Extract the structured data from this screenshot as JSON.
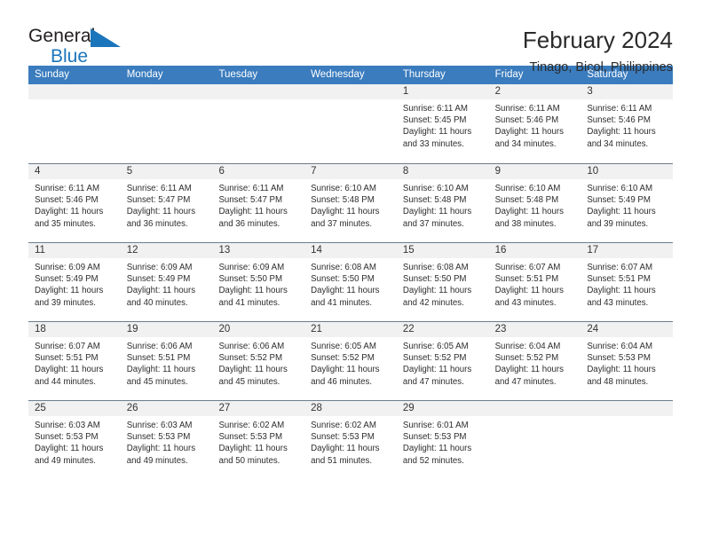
{
  "logo": {
    "word1": "General",
    "word2": "Blue",
    "accent_color": "#1b75bb"
  },
  "header": {
    "title": "February 2024",
    "location": "Tinago, Bicol, Philippines",
    "header_bg": "#3a7cbe"
  },
  "weekdays": [
    "Sunday",
    "Monday",
    "Tuesday",
    "Wednesday",
    "Thursday",
    "Friday",
    "Saturday"
  ],
  "labels": {
    "sunrise": "Sunrise:",
    "sunset": "Sunset:",
    "daylight": "Daylight:"
  },
  "weeks": [
    [
      {
        "day": "",
        "sunrise": "",
        "sunset": "",
        "daylight_1": "",
        "daylight_2": ""
      },
      {
        "day": "",
        "sunrise": "",
        "sunset": "",
        "daylight_1": "",
        "daylight_2": ""
      },
      {
        "day": "",
        "sunrise": "",
        "sunset": "",
        "daylight_1": "",
        "daylight_2": ""
      },
      {
        "day": "",
        "sunrise": "",
        "sunset": "",
        "daylight_1": "",
        "daylight_2": ""
      },
      {
        "day": "1",
        "sunrise": "Sunrise: 6:11 AM",
        "sunset": "Sunset: 5:45 PM",
        "daylight_1": "Daylight: 11 hours",
        "daylight_2": "and 33 minutes."
      },
      {
        "day": "2",
        "sunrise": "Sunrise: 6:11 AM",
        "sunset": "Sunset: 5:46 PM",
        "daylight_1": "Daylight: 11 hours",
        "daylight_2": "and 34 minutes."
      },
      {
        "day": "3",
        "sunrise": "Sunrise: 6:11 AM",
        "sunset": "Sunset: 5:46 PM",
        "daylight_1": "Daylight: 11 hours",
        "daylight_2": "and 34 minutes."
      }
    ],
    [
      {
        "day": "4",
        "sunrise": "Sunrise: 6:11 AM",
        "sunset": "Sunset: 5:46 PM",
        "daylight_1": "Daylight: 11 hours",
        "daylight_2": "and 35 minutes."
      },
      {
        "day": "5",
        "sunrise": "Sunrise: 6:11 AM",
        "sunset": "Sunset: 5:47 PM",
        "daylight_1": "Daylight: 11 hours",
        "daylight_2": "and 36 minutes."
      },
      {
        "day": "6",
        "sunrise": "Sunrise: 6:11 AM",
        "sunset": "Sunset: 5:47 PM",
        "daylight_1": "Daylight: 11 hours",
        "daylight_2": "and 36 minutes."
      },
      {
        "day": "7",
        "sunrise": "Sunrise: 6:10 AM",
        "sunset": "Sunset: 5:48 PM",
        "daylight_1": "Daylight: 11 hours",
        "daylight_2": "and 37 minutes."
      },
      {
        "day": "8",
        "sunrise": "Sunrise: 6:10 AM",
        "sunset": "Sunset: 5:48 PM",
        "daylight_1": "Daylight: 11 hours",
        "daylight_2": "and 37 minutes."
      },
      {
        "day": "9",
        "sunrise": "Sunrise: 6:10 AM",
        "sunset": "Sunset: 5:48 PM",
        "daylight_1": "Daylight: 11 hours",
        "daylight_2": "and 38 minutes."
      },
      {
        "day": "10",
        "sunrise": "Sunrise: 6:10 AM",
        "sunset": "Sunset: 5:49 PM",
        "daylight_1": "Daylight: 11 hours",
        "daylight_2": "and 39 minutes."
      }
    ],
    [
      {
        "day": "11",
        "sunrise": "Sunrise: 6:09 AM",
        "sunset": "Sunset: 5:49 PM",
        "daylight_1": "Daylight: 11 hours",
        "daylight_2": "and 39 minutes."
      },
      {
        "day": "12",
        "sunrise": "Sunrise: 6:09 AM",
        "sunset": "Sunset: 5:49 PM",
        "daylight_1": "Daylight: 11 hours",
        "daylight_2": "and 40 minutes."
      },
      {
        "day": "13",
        "sunrise": "Sunrise: 6:09 AM",
        "sunset": "Sunset: 5:50 PM",
        "daylight_1": "Daylight: 11 hours",
        "daylight_2": "and 41 minutes."
      },
      {
        "day": "14",
        "sunrise": "Sunrise: 6:08 AM",
        "sunset": "Sunset: 5:50 PM",
        "daylight_1": "Daylight: 11 hours",
        "daylight_2": "and 41 minutes."
      },
      {
        "day": "15",
        "sunrise": "Sunrise: 6:08 AM",
        "sunset": "Sunset: 5:50 PM",
        "daylight_1": "Daylight: 11 hours",
        "daylight_2": "and 42 minutes."
      },
      {
        "day": "16",
        "sunrise": "Sunrise: 6:07 AM",
        "sunset": "Sunset: 5:51 PM",
        "daylight_1": "Daylight: 11 hours",
        "daylight_2": "and 43 minutes."
      },
      {
        "day": "17",
        "sunrise": "Sunrise: 6:07 AM",
        "sunset": "Sunset: 5:51 PM",
        "daylight_1": "Daylight: 11 hours",
        "daylight_2": "and 43 minutes."
      }
    ],
    [
      {
        "day": "18",
        "sunrise": "Sunrise: 6:07 AM",
        "sunset": "Sunset: 5:51 PM",
        "daylight_1": "Daylight: 11 hours",
        "daylight_2": "and 44 minutes."
      },
      {
        "day": "19",
        "sunrise": "Sunrise: 6:06 AM",
        "sunset": "Sunset: 5:51 PM",
        "daylight_1": "Daylight: 11 hours",
        "daylight_2": "and 45 minutes."
      },
      {
        "day": "20",
        "sunrise": "Sunrise: 6:06 AM",
        "sunset": "Sunset: 5:52 PM",
        "daylight_1": "Daylight: 11 hours",
        "daylight_2": "and 45 minutes."
      },
      {
        "day": "21",
        "sunrise": "Sunrise: 6:05 AM",
        "sunset": "Sunset: 5:52 PM",
        "daylight_1": "Daylight: 11 hours",
        "daylight_2": "and 46 minutes."
      },
      {
        "day": "22",
        "sunrise": "Sunrise: 6:05 AM",
        "sunset": "Sunset: 5:52 PM",
        "daylight_1": "Daylight: 11 hours",
        "daylight_2": "and 47 minutes."
      },
      {
        "day": "23",
        "sunrise": "Sunrise: 6:04 AM",
        "sunset": "Sunset: 5:52 PM",
        "daylight_1": "Daylight: 11 hours",
        "daylight_2": "and 47 minutes."
      },
      {
        "day": "24",
        "sunrise": "Sunrise: 6:04 AM",
        "sunset": "Sunset: 5:53 PM",
        "daylight_1": "Daylight: 11 hours",
        "daylight_2": "and 48 minutes."
      }
    ],
    [
      {
        "day": "25",
        "sunrise": "Sunrise: 6:03 AM",
        "sunset": "Sunset: 5:53 PM",
        "daylight_1": "Daylight: 11 hours",
        "daylight_2": "and 49 minutes."
      },
      {
        "day": "26",
        "sunrise": "Sunrise: 6:03 AM",
        "sunset": "Sunset: 5:53 PM",
        "daylight_1": "Daylight: 11 hours",
        "daylight_2": "and 49 minutes."
      },
      {
        "day": "27",
        "sunrise": "Sunrise: 6:02 AM",
        "sunset": "Sunset: 5:53 PM",
        "daylight_1": "Daylight: 11 hours",
        "daylight_2": "and 50 minutes."
      },
      {
        "day": "28",
        "sunrise": "Sunrise: 6:02 AM",
        "sunset": "Sunset: 5:53 PM",
        "daylight_1": "Daylight: 11 hours",
        "daylight_2": "and 51 minutes."
      },
      {
        "day": "29",
        "sunrise": "Sunrise: 6:01 AM",
        "sunset": "Sunset: 5:53 PM",
        "daylight_1": "Daylight: 11 hours",
        "daylight_2": "and 52 minutes."
      },
      {
        "day": "",
        "sunrise": "",
        "sunset": "",
        "daylight_1": "",
        "daylight_2": ""
      },
      {
        "day": "",
        "sunrise": "",
        "sunset": "",
        "daylight_1": "",
        "daylight_2": ""
      }
    ]
  ]
}
